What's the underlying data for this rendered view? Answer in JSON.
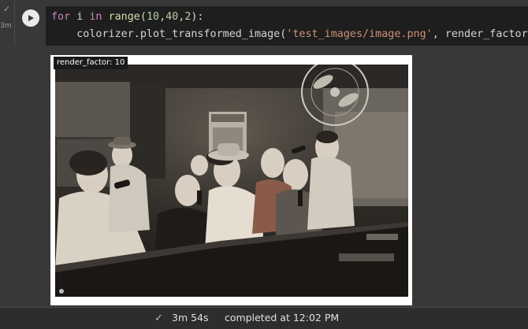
{
  "cell": {
    "exec_time": "3m",
    "code_line1": {
      "kw_for": "for",
      "var": " i ",
      "kw_in": "in",
      "sp": " ",
      "fn_range": "range",
      "open": "(",
      "n1": "10",
      "c1": ",",
      "n2": "40",
      "c2": ",",
      "n3": "2",
      "close": "):"
    },
    "code_line2": {
      "indent": "    ",
      "call": "colorizer.plot_transformed_image(",
      "str": "'test_images/image.png'",
      "rest": ", render_factor=i,"
    }
  },
  "output": {
    "render_label": "render_factor: 10"
  },
  "status": {
    "duration": "3m 54s",
    "completed": "completed at 12:02 PM"
  }
}
